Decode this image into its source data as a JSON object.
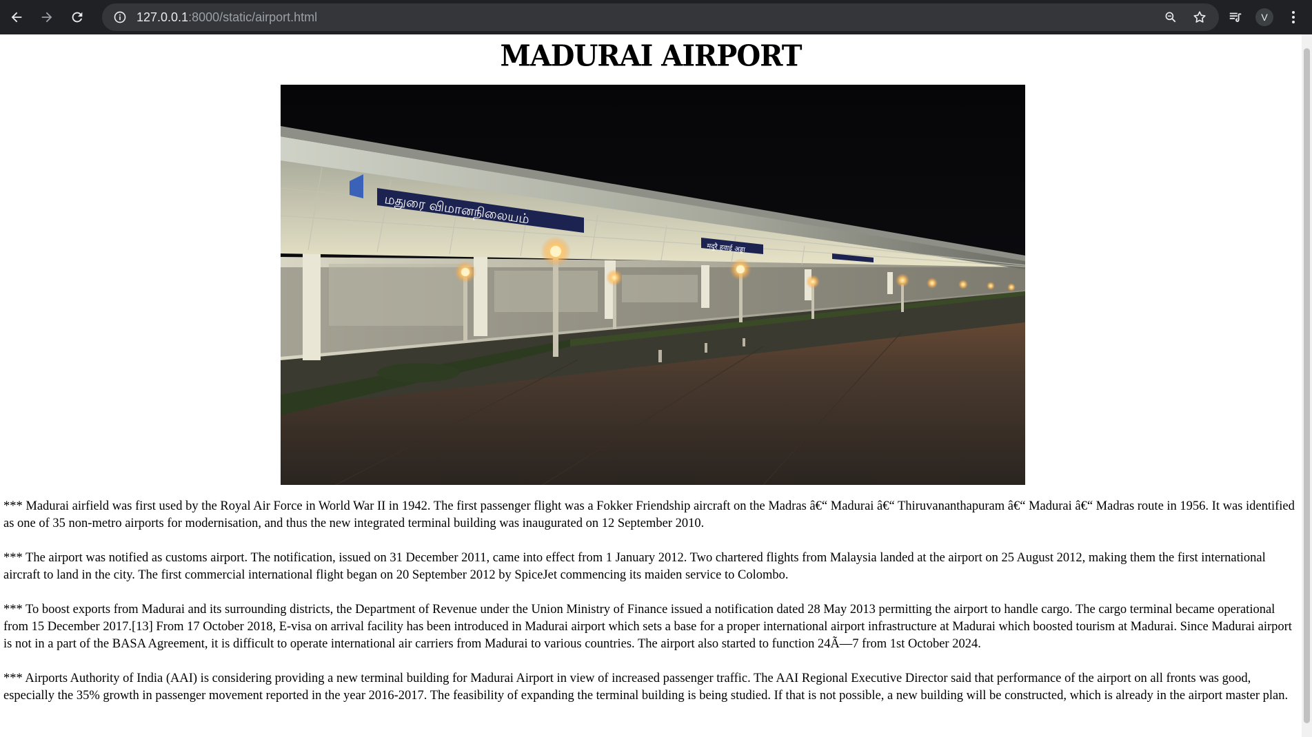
{
  "browser": {
    "url_host": "127.0.0.1",
    "url_path": ":8000/static/airport.html",
    "profile_initial": "V"
  },
  "icons": {
    "back": "arrow-left-icon",
    "forward": "arrow-right-icon",
    "reload": "reload-icon",
    "site_info": "info-icon",
    "zoom": "zoom-icon",
    "bookmark": "star-icon",
    "media": "media-queue-icon",
    "menu": "more-vert-icon"
  },
  "page": {
    "title": "MADURAI AIRPORT",
    "paragraphs": [
      "*** Madurai airfield was first used by the Royal Air Force in World War II in 1942. The first passenger flight was a Fokker Friendship aircraft on the Madras â€“ Madurai â€“ Thiruvananthapuram â€“ Madurai â€“ Madras route in 1956. It was identified as one of 35 non-metro airports for modernisation, and thus the new integrated terminal building was inaugurated on 12 September 2010.",
      "*** The airport was notified as customs airport. The notification, issued on 31 December 2011, came into effect from 1 January 2012. Two chartered flights from Malaysia landed at the airport on 25 August 2012, making them the first international aircraft to land in the city. The first commercial international flight began on 20 September 2012 by SpiceJet commencing its maiden service to Colombo.",
      "*** To boost exports from Madurai and its surrounding districts, the Department of Revenue under the Union Ministry of Finance issued a notification dated 28 May 2013 permitting the airport to handle cargo. The cargo terminal became operational from 15 December 2017.[13] From 17 October 2018, E-visa on arrival facility has been introduced in Madurai airport which sets a base for a proper international airport infrastructure at Madurai which boosted tourism at Madurai. Since Madurai airport is not in a part of the BASA Agreement, it is difficult to operate international air carriers from Madurai to various countries. The airport also started to function 24Ã—7 from 1st October 2024.",
      "*** Airports Authority of India (AAI) is considering providing a new terminal building for Madurai Airport in view of increased passenger traffic. The AAI Regional Executive Director said that performance of the airport on all fronts was good, especially the 35% growth in passenger movement reported in the year 2016-2017. The feasibility of expanding the terminal building is being studied. If that is not possible, a new building will be constructed, which is already in the airport master plan."
    ],
    "photo": {
      "sign_text": "மதுரை விமானநிலையம்",
      "sign_text_2": "मदुरै हवाई अड्डा"
    }
  }
}
